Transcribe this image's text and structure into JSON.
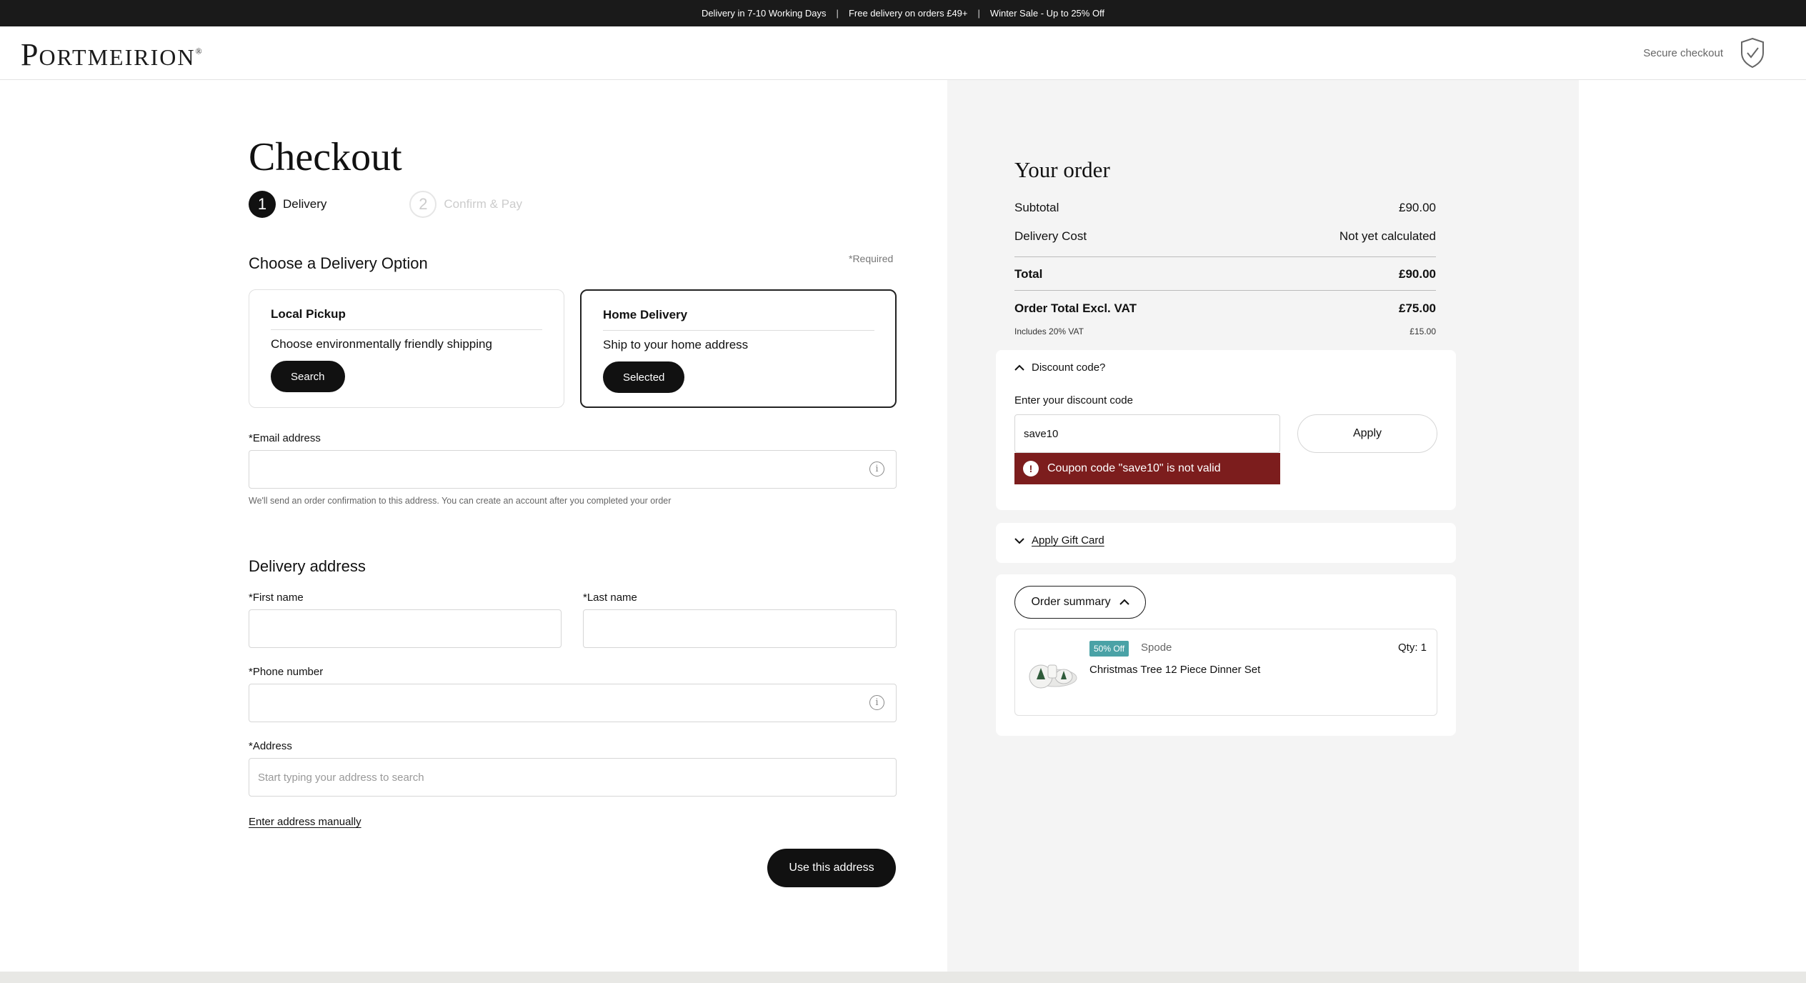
{
  "topbar": {
    "items": [
      "Delivery in 7-10 Working Days",
      "Free delivery on orders £49+",
      "Winter Sale - Up to 25% Off"
    ],
    "separator": "|"
  },
  "header": {
    "logo_first": "P",
    "logo_rest": "ORTMEIRION",
    "logo_mark": "®",
    "secure_label": "Secure checkout",
    "secure_icon": "shield-check-icon"
  },
  "checkout": {
    "title": "Checkout",
    "steps": [
      {
        "number": "1",
        "label": "Delivery"
      },
      {
        "number": "2",
        "label": "Confirm & Pay"
      }
    ],
    "delivery_option_heading": "Choose a Delivery Option",
    "required_note": "*Required",
    "options": [
      {
        "title": "Local Pickup",
        "desc": "Choose environmentally friendly shipping",
        "button": "Search"
      },
      {
        "title": "Home Delivery",
        "desc": "Ship to your home address",
        "button": "Selected"
      }
    ],
    "email": {
      "label": "*Email address",
      "value": "",
      "hint": "We'll send an order confirmation to this address. You can create an account after you completed your order"
    },
    "address_heading": "Delivery address",
    "first_name": {
      "label": "*First name",
      "value": ""
    },
    "last_name": {
      "label": "*Last name",
      "value": ""
    },
    "phone": {
      "label": "*Phone number",
      "value": ""
    },
    "address": {
      "label": "*Address",
      "placeholder": "Start typing your address to search"
    },
    "manual_link": "Enter address manually",
    "use_address_button": "Use this address"
  },
  "order": {
    "title": "Your order",
    "subtotal_label": "Subtotal",
    "subtotal": "£90.00",
    "delivery_label": "Delivery Cost",
    "delivery": "Not yet calculated",
    "total_label": "Total",
    "total": "£90.00",
    "excl_vat_label": "Order Total Excl. VAT",
    "excl_vat": "£75.00",
    "vat_label": "Includes 20% VAT",
    "vat": "£15.00"
  },
  "discount": {
    "toggle": "Discount code?",
    "label": "Enter your discount code",
    "value": "save10",
    "apply": "Apply",
    "error": "Coupon code \"save10\" is not valid"
  },
  "gift": {
    "toggle": "Apply Gift Card"
  },
  "summary": {
    "button": "Order summary",
    "item": {
      "badge": "50% Off",
      "brand": "Spode",
      "qty": "Qty: 1",
      "name": "Christmas Tree 12 Piece Dinner Set"
    }
  }
}
